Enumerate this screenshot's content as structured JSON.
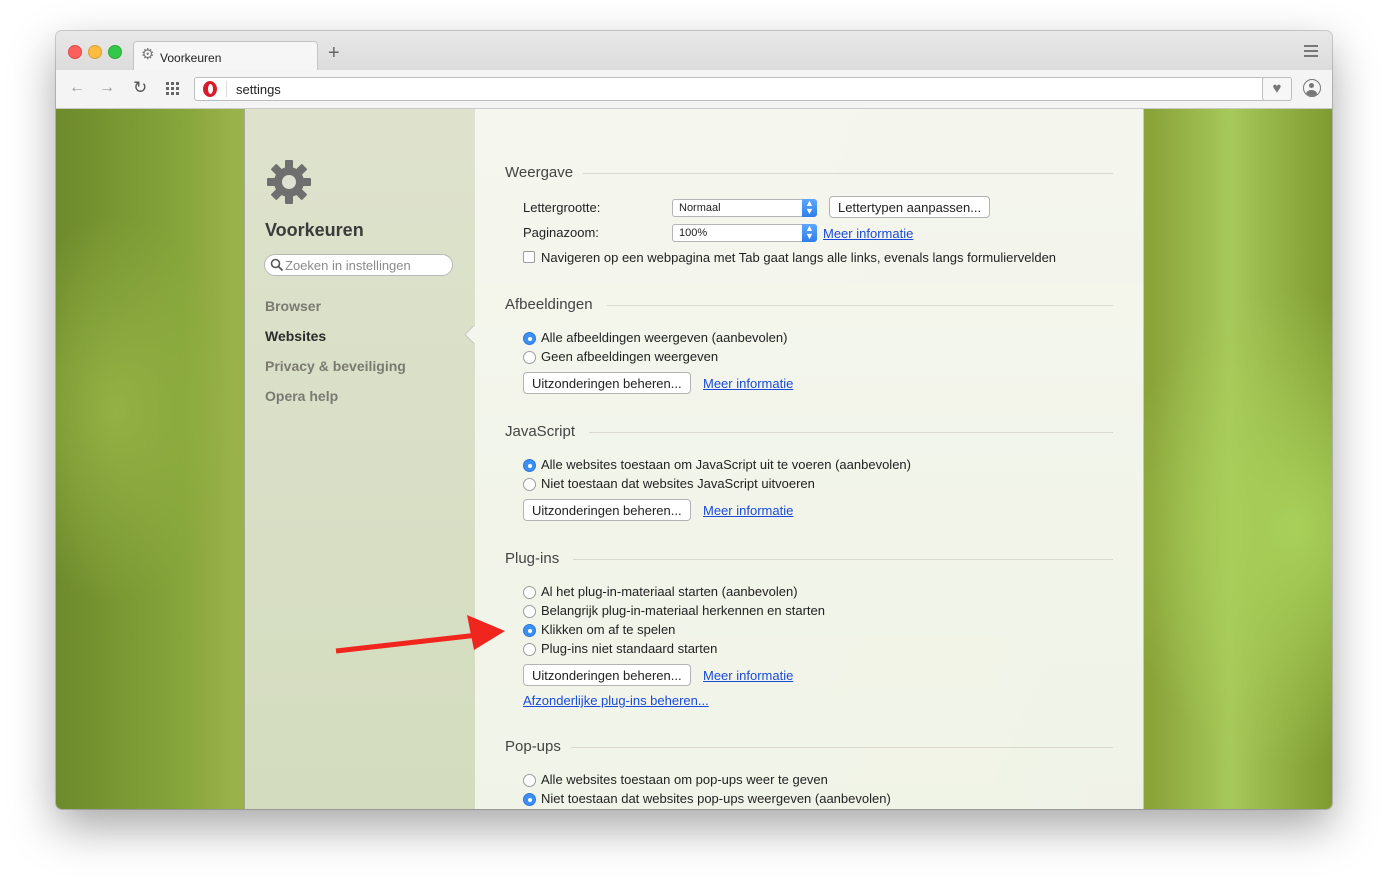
{
  "tab": {
    "title": "Voorkeuren",
    "icon": "gear-icon"
  },
  "address": {
    "url": "settings"
  },
  "sidebar": {
    "title": "Voorkeuren",
    "search_placeholder": "Zoeken in instellingen",
    "items": [
      {
        "label": "Browser"
      },
      {
        "label": "Websites"
      },
      {
        "label": "Privacy & beveiliging"
      },
      {
        "label": "Opera help"
      }
    ]
  },
  "weergave": {
    "heading": "Weergave",
    "font_size_label": "Lettergrootte:",
    "font_size_value": "Normaal",
    "customize_fonts": "Lettertypen aanpassen...",
    "page_zoom_label": "Paginazoom:",
    "page_zoom_value": "100%",
    "more_info": "Meer informatie",
    "tab_nav_label": "Navigeren op een webpagina met Tab gaat langs alle links, evenals langs formuliervelden"
  },
  "afbeeldingen": {
    "heading": "Afbeeldingen",
    "options": [
      {
        "label": "Alle afbeeldingen weergeven (aanbevolen)",
        "selected": true
      },
      {
        "label": "Geen afbeeldingen weergeven",
        "selected": false
      }
    ],
    "exceptions": "Uitzonderingen beheren...",
    "more_info": "Meer informatie"
  },
  "javascript": {
    "heading": "JavaScript",
    "options": [
      {
        "label": "Alle websites toestaan om JavaScript uit te voeren (aanbevolen)",
        "selected": true
      },
      {
        "label": "Niet toestaan dat websites JavaScript uitvoeren",
        "selected": false
      }
    ],
    "exceptions": "Uitzonderingen beheren...",
    "more_info": "Meer informatie"
  },
  "plugins": {
    "heading": "Plug-ins",
    "options": [
      {
        "label": "Al het plug-in-materiaal starten (aanbevolen)",
        "selected": false
      },
      {
        "label": "Belangrijk plug-in-materiaal herkennen en starten",
        "selected": false
      },
      {
        "label": "Klikken om af te spelen",
        "selected": true
      },
      {
        "label": "Plug-ins niet standaard starten",
        "selected": false
      }
    ],
    "exceptions": "Uitzonderingen beheren...",
    "more_info": "Meer informatie",
    "manage_individual": "Afzonderlijke plug-ins beheren..."
  },
  "popups": {
    "heading": "Pop-ups",
    "options": [
      {
        "label": "Alle websites toestaan om pop-ups weer te geven",
        "selected": false
      },
      {
        "label": "Niet toestaan dat websites pop-ups weergeven (aanbevolen)",
        "selected": true
      }
    ]
  },
  "colors": {
    "radio_on": "#3b8ff5",
    "link": "#1a4bd8",
    "annotation_arrow": "#f0261e"
  }
}
